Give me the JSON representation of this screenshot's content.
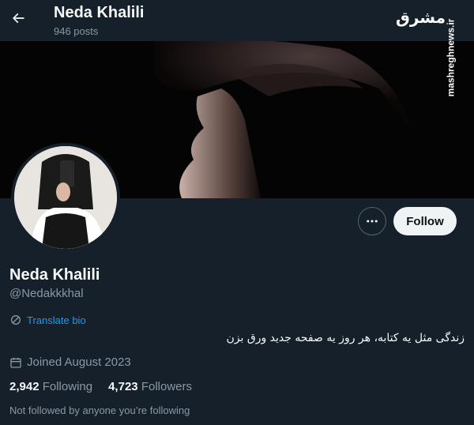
{
  "header": {
    "title": "Neda Khalili",
    "post_count": "946 posts"
  },
  "watermark": {
    "logo_text": "مشرق",
    "site": "mashreghnews.ir"
  },
  "profile": {
    "name": "Neda Khalili",
    "handle": "@Nedakkkhal",
    "translate_label": "Translate bio",
    "bio": "زندگی مثل یه کتابه، هر روز یه صفحه جدید ورق بزن",
    "joined": "Joined August 2023",
    "following_count": "2,942",
    "following_label": "Following",
    "followers_count": "4,723",
    "followers_label": "Followers",
    "followed_note": "Not followed by anyone you’re following"
  },
  "actions": {
    "follow_label": "Follow"
  },
  "colors": {
    "background": "#15202b",
    "accent": "#1d9bf0",
    "muted_text": "#8b98a5"
  }
}
